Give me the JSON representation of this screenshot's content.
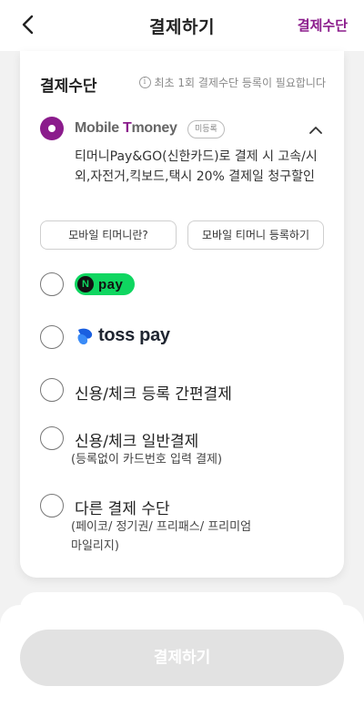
{
  "header": {
    "title": "결제하기",
    "right_link": "결제수단"
  },
  "payment_section": {
    "title": "결제수단",
    "notice": "최초 1회 결제수단 등록이 필요합니다"
  },
  "tmoney": {
    "logo_prefix": "Mobile ",
    "logo_t": "T",
    "logo_suffix": "money",
    "badge": "미등록",
    "description": "티머니Pay&GO(신한카드)로 결제 시 고속/시외,자전거,킥보드,택시 20% 결제일 청구할인",
    "button_info": "모바일 티머니란?",
    "button_register": "모바일 티머니 등록하기",
    "selected": true
  },
  "options": {
    "npay": {
      "n": "N",
      "text": "pay"
    },
    "toss": {
      "text": "toss pay"
    },
    "card_simple": {
      "label": "신용/체크 등록 간편결제"
    },
    "card_general": {
      "label": "신용/체크 일반결제",
      "sub": "(등록없이 카드번호 입력 결제)"
    },
    "other": {
      "label": "다른 결제 수단",
      "sub_line1": "(페이코/ 정기권/ 프리패스/ 프리미엄",
      "sub_line2": "마일리지)"
    }
  },
  "footer": {
    "pay_button": "결제하기"
  },
  "colors": {
    "brand_purple": "#8b1c8c",
    "npay_green": "#0fd660",
    "disabled_button": "#e2e2e2"
  }
}
